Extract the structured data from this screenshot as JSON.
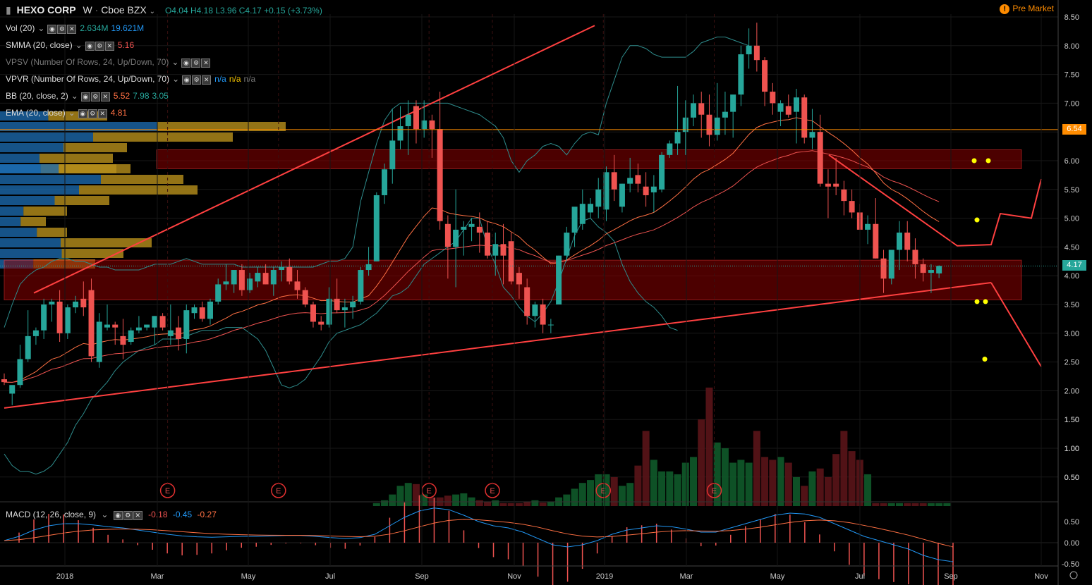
{
  "header": {
    "symbol": "HEXO CORP",
    "interval": "W",
    "exchange": "Cboe BZX",
    "ohlc": {
      "open": "O4.04",
      "high": "H4.18",
      "low": "L3.96",
      "close": "C4.17"
    },
    "change": "+0.15 (+3.73%)",
    "session": "Pre Market",
    "session_icon": "!"
  },
  "indicators": [
    {
      "name": "Vol (20)",
      "values": [
        "2.634M",
        "19.621M"
      ],
      "colors": [
        "#26a69a",
        "#2196f3"
      ]
    },
    {
      "name": "SMMA (20, close)",
      "values": [
        "5.16"
      ],
      "colors": [
        "#ef5350"
      ]
    },
    {
      "name": "VPSV (Number Of Rows, 24, Up/Down, 70)",
      "values": [],
      "colors": []
    },
    {
      "name": "VPVR (Number Of Rows, 24, Up/Down, 70)",
      "values": [
        "n/a",
        "n/a",
        "n/a"
      ],
      "colors": [
        "#2196f3",
        "#f0c000",
        "#777777"
      ]
    },
    {
      "name": "BB (20, close, 2)",
      "values": [
        "5.52",
        "7.98",
        "3.05"
      ],
      "colors": [
        "#ff7043",
        "#26a69a",
        "#26a69a"
      ]
    },
    {
      "name": "EMA (20, close)",
      "values": [
        "4.81"
      ],
      "colors": [
        "#ff7043"
      ]
    }
  ],
  "macd_legend": {
    "name": "MACD (12, 26, close, 9)",
    "values": [
      "-0.18",
      "-0.45",
      "-0.27"
    ],
    "colors": [
      "#ef5350",
      "#2196f3",
      "#ff7043"
    ]
  },
  "price_tags": [
    {
      "label": "6.54",
      "price": 6.54,
      "color": "#ff8c00"
    },
    {
      "label": "4.17",
      "price": 4.17,
      "color": "#26a69a"
    }
  ],
  "earnings_label": "E",
  "colors": {
    "up": "#26a69a",
    "down": "#ef5350",
    "bb": "#2e8c8c",
    "ema": "#ff7043",
    "smma": "#ef5350",
    "trend": "#ff4040",
    "zone": "#8b0000",
    "vp_up": "#1e6fb5",
    "vp_down": "#b8901c",
    "marker": "#ffff00"
  },
  "chart_data": {
    "type": "candlestick",
    "interval": "weekly",
    "y_price_range": [
      1.5,
      8.6
    ],
    "y_ticks": [
      "8.50",
      "8.00",
      "7.50",
      "7.00",
      "6.50",
      "6.00",
      "5.50",
      "5.00",
      "4.50",
      "4.00",
      "3.50",
      "3.00",
      "2.50",
      "2.00",
      "1.50",
      "1.00",
      "0.50"
    ],
    "volume_ticks": [
      "1.50",
      "1.00",
      "0.50"
    ],
    "x_labels": [
      "2018",
      "Mar",
      "May",
      "Jul",
      "Sep",
      "Nov",
      "2019",
      "Mar",
      "May",
      "Jul",
      "Sep",
      "Nov"
    ],
    "macd_ticks": [
      "0.50",
      "0.00",
      "-0.50"
    ],
    "earnings_weeks": [
      20,
      34,
      53,
      61,
      75,
      89
    ],
    "candles": [
      [
        2.2,
        2.3,
        2.1,
        2.15
      ],
      [
        1.95,
        2.05,
        1.75,
        2.1
      ],
      [
        2.1,
        2.8,
        2.05,
        2.55
      ],
      [
        2.55,
        3.4,
        2.5,
        2.95
      ],
      [
        2.95,
        3.1,
        2.8,
        3.05
      ],
      [
        3.05,
        3.6,
        2.9,
        3.5
      ],
      [
        3.5,
        3.6,
        3.2,
        3.55
      ],
      [
        3.55,
        3.75,
        2.85,
        3.0
      ],
      [
        3.0,
        3.5,
        2.9,
        3.45
      ],
      [
        3.45,
        3.65,
        3.35,
        3.55
      ],
      [
        3.6,
        3.9,
        3.3,
        3.45
      ],
      [
        3.75,
        3.95,
        2.5,
        2.6
      ],
      [
        2.5,
        3.35,
        2.4,
        3.2
      ],
      [
        3.1,
        3.5,
        3.05,
        3.15
      ],
      [
        3.15,
        3.2,
        2.8,
        3.1
      ],
      [
        2.95,
        3.25,
        2.55,
        2.8
      ],
      [
        2.85,
        3.1,
        2.8,
        3.05
      ],
      [
        3.05,
        3.3,
        3.0,
        3.1
      ],
      [
        3.1,
        3.15,
        3.05,
        3.15
      ],
      [
        3.1,
        3.3,
        2.8,
        3.3
      ],
      [
        3.3,
        3.35,
        3.05,
        3.1
      ],
      [
        2.95,
        3.5,
        2.8,
        3.05
      ],
      [
        3.1,
        3.3,
        2.7,
        2.9
      ],
      [
        2.9,
        3.5,
        2.65,
        3.4
      ],
      [
        3.35,
        3.5,
        3.25,
        3.45
      ],
      [
        3.45,
        3.55,
        3.2,
        3.25
      ],
      [
        3.25,
        3.6,
        3.15,
        3.55
      ],
      [
        3.55,
        3.95,
        3.5,
        3.85
      ],
      [
        3.85,
        4.2,
        3.75,
        3.9
      ],
      [
        3.85,
        4.1,
        3.7,
        4.1
      ],
      [
        4.1,
        4.2,
        3.65,
        3.75
      ],
      [
        3.75,
        4.05,
        3.7,
        3.95
      ],
      [
        3.9,
        4.15,
        3.8,
        4.05
      ],
      [
        4.05,
        4.2,
        3.85,
        3.85
      ],
      [
        3.85,
        4.15,
        3.65,
        4.1
      ],
      [
        4.1,
        4.25,
        3.9,
        4.15
      ],
      [
        4.15,
        4.3,
        3.85,
        3.9
      ],
      [
        3.9,
        4.1,
        3.6,
        3.75
      ],
      [
        3.75,
        3.8,
        3.45,
        3.5
      ],
      [
        3.5,
        3.55,
        3.1,
        3.2
      ],
      [
        3.2,
        3.3,
        3.05,
        3.15
      ],
      [
        3.15,
        3.8,
        3.1,
        3.6
      ],
      [
        3.6,
        3.95,
        3.35,
        3.4
      ],
      [
        3.4,
        3.6,
        3.1,
        3.45
      ],
      [
        3.45,
        3.65,
        3.25,
        3.55
      ],
      [
        3.55,
        4.15,
        3.5,
        4.1
      ],
      [
        4.1,
        4.5,
        4.0,
        4.2
      ],
      [
        4.25,
        5.45,
        4.25,
        5.4
      ],
      [
        5.4,
        5.95,
        5.25,
        5.85
      ],
      [
        5.85,
        6.9,
        5.6,
        6.35
      ],
      [
        6.35,
        6.95,
        6.2,
        6.6
      ],
      [
        6.6,
        7.05,
        6.1,
        6.8
      ],
      [
        6.95,
        7.05,
        6.3,
        6.55
      ],
      [
        6.55,
        7.05,
        6.4,
        6.7
      ],
      [
        6.7,
        6.8,
        6.05,
        6.55
      ],
      [
        6.55,
        7.2,
        4.8,
        4.95
      ],
      [
        4.9,
        5.05,
        3.95,
        4.5
      ],
      [
        4.5,
        5.5,
        3.8,
        4.8
      ],
      [
        4.8,
        4.95,
        4.35,
        4.85
      ],
      [
        4.85,
        5.0,
        4.6,
        4.9
      ],
      [
        4.85,
        5.1,
        4.4,
        4.75
      ],
      [
        4.75,
        4.95,
        4.3,
        4.35
      ],
      [
        4.35,
        4.75,
        4.0,
        4.55
      ],
      [
        4.55,
        4.9,
        3.85,
        4.35
      ],
      [
        4.6,
        4.75,
        3.85,
        3.9
      ],
      [
        4.05,
        4.15,
        3.6,
        3.85
      ],
      [
        3.8,
        3.95,
        3.15,
        3.3
      ],
      [
        3.3,
        3.55,
        3.1,
        3.5
      ],
      [
        3.5,
        3.6,
        3.0,
        3.15
      ],
      [
        3.15,
        3.25,
        3.0,
        3.15
      ],
      [
        3.5,
        4.35,
        3.5,
        4.35
      ],
      [
        4.35,
        4.85,
        4.25,
        4.75
      ],
      [
        4.75,
        5.1,
        4.5,
        5.2
      ],
      [
        4.9,
        5.5,
        4.8,
        5.25
      ],
      [
        5.1,
        5.35,
        5.0,
        5.25
      ],
      [
        5.2,
        5.7,
        5.0,
        5.5
      ],
      [
        5.15,
        5.9,
        4.95,
        5.8
      ],
      [
        5.8,
        6.1,
        5.3,
        5.5
      ],
      [
        5.2,
        5.6,
        5.1,
        5.6
      ],
      [
        5.6,
        6.05,
        5.45,
        5.7
      ],
      [
        5.75,
        5.95,
        5.45,
        5.6
      ],
      [
        5.55,
        5.8,
        5.2,
        5.4
      ],
      [
        5.45,
        5.75,
        5.1,
        5.55
      ],
      [
        5.5,
        6.15,
        5.45,
        6.1
      ],
      [
        6.1,
        6.35,
        6.05,
        6.3
      ],
      [
        6.3,
        7.3,
        6.1,
        6.5
      ],
      [
        6.5,
        7.05,
        6.1,
        6.75
      ],
      [
        6.75,
        7.15,
        6.6,
        7.0
      ],
      [
        7.0,
        7.2,
        6.4,
        6.8
      ],
      [
        6.8,
        7.15,
        6.25,
        6.45
      ],
      [
        6.45,
        7.35,
        6.35,
        6.75
      ],
      [
        6.75,
        7.2,
        6.45,
        6.85
      ],
      [
        6.85,
        7.0,
        6.4,
        7.15
      ],
      [
        7.15,
        8.0,
        6.95,
        7.85
      ],
      [
        7.85,
        8.3,
        7.6,
        8.0
      ],
      [
        8.0,
        8.4,
        7.55,
        7.75
      ],
      [
        7.75,
        7.8,
        6.95,
        7.2
      ],
      [
        7.2,
        7.35,
        6.8,
        7.0
      ],
      [
        6.85,
        7.05,
        6.6,
        7.0
      ],
      [
        6.95,
        7.15,
        6.75,
        6.8
      ],
      [
        6.85,
        7.25,
        6.3,
        7.1
      ],
      [
        7.1,
        7.15,
        6.3,
        6.4
      ],
      [
        6.4,
        6.9,
        6.2,
        6.5
      ],
      [
        6.5,
        6.8,
        5.55,
        5.6
      ],
      [
        5.6,
        5.85,
        5.0,
        5.55
      ],
      [
        5.6,
        6.05,
        5.4,
        5.55
      ],
      [
        5.5,
        5.65,
        5.05,
        5.3
      ],
      [
        5.3,
        5.5,
        5.0,
        5.1
      ],
      [
        5.1,
        5.25,
        4.9,
        4.8
      ],
      [
        4.8,
        5.05,
        4.55,
        4.9
      ],
      [
        4.9,
        5.35,
        4.3,
        4.3
      ],
      [
        4.3,
        4.45,
        3.7,
        3.95
      ],
      [
        3.95,
        4.35,
        3.85,
        4.45
      ],
      [
        4.45,
        4.95,
        4.1,
        4.75
      ],
      [
        4.75,
        4.95,
        4.25,
        4.45
      ],
      [
        4.45,
        4.65,
        3.95,
        4.2
      ],
      [
        4.2,
        4.3,
        3.9,
        4.05
      ],
      [
        4.05,
        4.2,
        3.7,
        4.1
      ],
      [
        4.04,
        4.18,
        3.96,
        4.17
      ]
    ],
    "volume_weeks": [
      47,
      48,
      49,
      50,
      51,
      52,
      53,
      54,
      55,
      56,
      57,
      58,
      59,
      60,
      61,
      62,
      63,
      64,
      65,
      66,
      67,
      68,
      69,
      70,
      71,
      72,
      73,
      74,
      75,
      76,
      77,
      78,
      79,
      80,
      81,
      82,
      83,
      84,
      85,
      86,
      87,
      88,
      89,
      90,
      91,
      92,
      93,
      94,
      95,
      96,
      97,
      98,
      99,
      100,
      101,
      102,
      103,
      104,
      105,
      106,
      107,
      108,
      109,
      110,
      111,
      112,
      113,
      114,
      115,
      116,
      117,
      118,
      119
    ],
    "volumes": [
      0.05,
      0.1,
      0.2,
      0.35,
      0.4,
      0.38,
      0.2,
      0.15,
      0.15,
      0.18,
      0.2,
      0.22,
      0.15,
      0.1,
      0.08,
      0.1,
      0.05,
      0.05,
      0.05,
      0.08,
      0.1,
      0.06,
      0.08,
      0.15,
      0.2,
      0.3,
      0.4,
      0.45,
      0.55,
      0.55,
      0.5,
      0.35,
      0.4,
      0.7,
      1.3,
      0.8,
      0.6,
      0.6,
      0.55,
      0.75,
      0.85,
      1.5,
      2.05,
      1.1,
      1.0,
      0.75,
      0.8,
      0.75,
      1.3,
      0.85,
      0.8,
      0.85,
      0.75,
      0.5,
      0.35,
      0.6,
      0.65,
      0.5,
      0.9,
      1.3,
      0.95,
      0.8,
      0.55,
      0.05,
      0.05,
      0.05,
      0.05,
      0.05,
      0.05,
      0.05,
      0.05,
      0.05,
      0.05
    ],
    "macd_range": [
      -0.5,
      0.8
    ],
    "bb_upper": [
      3.1,
      3.5,
      3.85,
      4.0,
      4.1,
      4.15,
      4.25,
      4.3,
      4.3,
      4.25,
      4.25,
      4.2,
      4.15,
      4.15,
      4.1,
      4.1,
      4.1,
      4.1,
      4.15,
      4.2,
      4.2,
      4.2,
      4.25,
      4.3,
      4.25,
      4.2,
      4.2,
      4.2,
      4.2,
      4.2,
      4.15,
      4.15,
      4.15,
      4.15,
      4.15,
      4.15,
      4.15,
      4.15,
      4.15,
      4.15,
      4.2,
      4.25,
      4.25,
      4.3,
      4.5,
      5.3,
      5.8,
      6.3,
      6.7,
      6.9,
      7.0,
      7.0,
      7.0,
      7.0,
      7.0,
      7.0,
      7.0,
      6.95,
      6.9,
      6.85,
      6.8,
      6.7,
      6.6,
      6.4,
      6.0,
      5.8,
      6.0,
      6.1,
      6.25,
      6.3,
      6.25,
      6.1,
      6.3,
      6.45,
      6.5,
      6.45,
      7.0,
      7.4,
      7.8,
      8.0,
      8.0,
      7.95,
      7.85,
      7.8,
      7.8,
      7.8,
      7.8,
      7.9,
      8.05,
      8.1,
      8.15,
      8.15,
      8.1,
      8.05,
      8.0
    ],
    "bb_lower": [
      0.9,
      0.7,
      0.6,
      0.6,
      0.55,
      0.6,
      0.7,
      0.9,
      1.1,
      1.4,
      1.6,
      1.85,
      2.0,
      2.15,
      2.35,
      2.5,
      2.6,
      2.7,
      2.75,
      2.8,
      2.9,
      2.9,
      2.9,
      2.95,
      3.0,
      3.05,
      3.05,
      3.05,
      3.1,
      3.1,
      3.1,
      3.0,
      2.9,
      2.7,
      2.4,
      2.1,
      2.05,
      2.1,
      2.2,
      2.4,
      2.6,
      2.85,
      3.0,
      3.05,
      3.1,
      3.15,
      3.25,
      3.35,
      3.5,
      3.65,
      3.7,
      3.8,
      4.0,
      4.2,
      4.3,
      4.4,
      4.5,
      4.6,
      4.8,
      5.0,
      5.0,
      4.5,
      4.2,
      3.8,
      3.65,
      3.45,
      3.3,
      3.2,
      3.35,
      3.55,
      3.9,
      4.3,
      4.7,
      4.95,
      5.0,
      4.85,
      4.75,
      4.6,
      4.2,
      3.9,
      3.7,
      3.55,
      3.45,
      3.3,
      3.1,
      3.05
    ],
    "macd_line": [
      0.05,
      0.15,
      0.3,
      0.4,
      0.45,
      0.45,
      0.42,
      0.38,
      0.35,
      0.3,
      0.25,
      0.2,
      0.16,
      0.14,
      0.13,
      0.14,
      0.15,
      0.15,
      0.16,
      0.17,
      0.17,
      0.15,
      0.12,
      0.1,
      0.12,
      0.2,
      0.4,
      0.6,
      0.75,
      0.82,
      0.78,
      0.65,
      0.5,
      0.4,
      0.35,
      0.25,
      0.1,
      -0.05,
      -0.1,
      -0.05,
      0.05,
      0.2,
      0.3,
      0.35,
      0.4,
      0.38,
      0.32,
      0.25,
      0.25,
      0.35,
      0.45,
      0.55,
      0.65,
      0.7,
      0.68,
      0.6,
      0.45,
      0.3,
      0.15,
      0.05,
      -0.05,
      -0.15,
      -0.3,
      -0.4,
      -0.45
    ]
  }
}
